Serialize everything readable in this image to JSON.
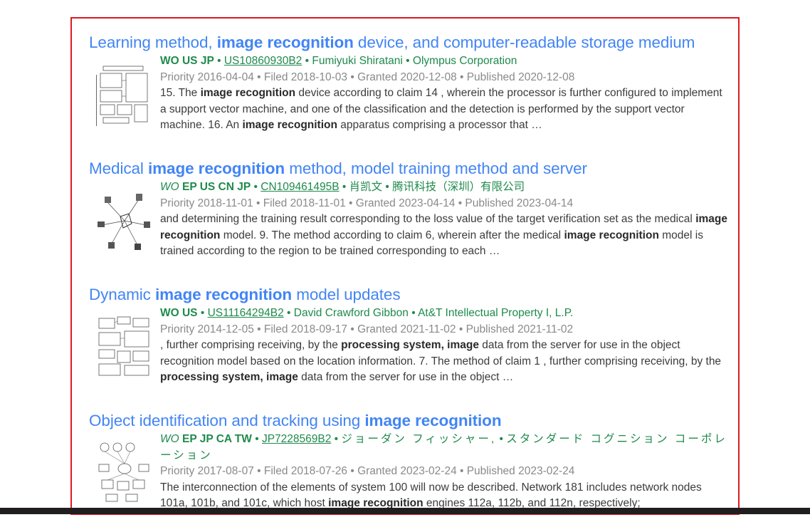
{
  "results": [
    {
      "title_parts": [
        "Learning method, ",
        "image recognition",
        " device, and computer-readable storage medium"
      ],
      "countries_strong": "WO US JP",
      "countries_italic": "",
      "patent_id": "US10860930B2",
      "inventor": "Fumiyuki Shiratani",
      "assignee": "Olympus Corporation",
      "dates": "Priority 2016-04-04 • Filed 2018-10-03 • Granted 2020-12-08 • Published 2020-12-08",
      "snippet": [
        {
          "t": "15. The "
        },
        {
          "b": "image recognition"
        },
        {
          "t": " device according to claim 14 , wherein the processor is further configured to implement a support vector machine, and one of the classification and the detection is performed by the support vector machine. 16. An "
        },
        {
          "b": "image recognition"
        },
        {
          "t": " apparatus comprising a processor that …"
        }
      ]
    },
    {
      "title_parts": [
        "Medical ",
        "image recognition",
        " method, model training method and server"
      ],
      "countries_strong": "EP US CN JP",
      "countries_italic": "WO",
      "patent_id": "CN109461495B",
      "inventor": "肖凯文",
      "assignee": "腾讯科技（深圳）有限公司",
      "dates": "Priority 2018-11-01 • Filed 2018-11-01 • Granted 2023-04-14 • Published 2023-04-14",
      "snippet": [
        {
          "t": "and determining the training result corresponding to the loss value of the target verification set as the medical "
        },
        {
          "b": "image recognition"
        },
        {
          "t": " model. 9. The method according to claim 6, wherein after the medical "
        },
        {
          "b": "image recognition"
        },
        {
          "t": " model is trained according to the region to be trained corresponding to each …"
        }
      ]
    },
    {
      "title_parts": [
        "Dynamic ",
        "image recognition",
        " model updates"
      ],
      "countries_strong": "WO US",
      "countries_italic": "",
      "patent_id": "US11164294B2",
      "inventor": "David Crawford Gibbon",
      "assignee": "At&T Intellectual Property I, L.P.",
      "dates": "Priority 2014-12-05 • Filed 2018-09-17 • Granted 2021-11-02 • Published 2021-11-02",
      "snippet": [
        {
          "t": ", further comprising receiving, by the "
        },
        {
          "b": "processing system, image"
        },
        {
          "t": " data from the server for use in the object recognition model based on the location information. 7. The method of claim 1 , further comprising receiving, by the "
        },
        {
          "b": "processing system, image"
        },
        {
          "t": " data from the server for use in the object …"
        }
      ]
    },
    {
      "title_parts": [
        "Object identification and tracking using ",
        "image recognition",
        ""
      ],
      "countries_strong": "EP JP CA TW",
      "countries_italic": "WO",
      "patent_id": "JP7228569B2",
      "inventor": "ジョーダン フィッシャー,",
      "assignee": "スタンダード コグニション コーポレーション",
      "dates": "Priority 2017-08-07 • Filed 2018-07-26 • Granted 2023-02-24 • Published 2023-02-24",
      "snippet": [
        {
          "t": "The interconnection of the elements of system 100 will now be described. Network 181 includes network nodes 101a, 101b, and 101c, which host "
        },
        {
          "b": "image recognition"
        },
        {
          "t": " engines 112a, 112b, and 112n, respectively;"
        }
      ]
    }
  ],
  "colors": {
    "title": "#4285f4",
    "meta_green": "#1f8a4c",
    "dates_gray": "#8a8a8a",
    "frame_red": "#e0181e"
  },
  "icons": [
    "patent-drawing-thumbnail"
  ]
}
